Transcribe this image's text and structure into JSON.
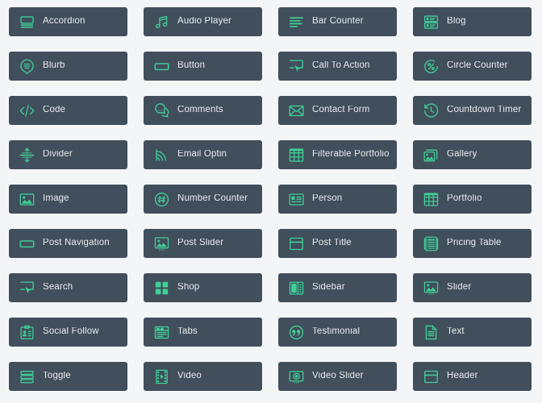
{
  "theme": {
    "page_background": "#f4f5f7",
    "tile_background": "#414e5c",
    "icon_color": "#3ecf96",
    "label_color": "#e9ecef"
  },
  "grid": {
    "columns": 4,
    "rows": 9,
    "total_modules": 36
  },
  "modules": [
    {
      "label": "Accordion",
      "icon": "accordion-icon"
    },
    {
      "label": "Audio Player",
      "icon": "music-note-icon"
    },
    {
      "label": "Bar Counter",
      "icon": "bar-counter-icon"
    },
    {
      "label": "Blog",
      "icon": "blog-list-icon"
    },
    {
      "label": "Blurb",
      "icon": "speech-bubble-lines-icon"
    },
    {
      "label": "Button",
      "icon": "rounded-rect-icon"
    },
    {
      "label": "Call To Action",
      "icon": "screen-cursor-icon"
    },
    {
      "label": "Circle Counter",
      "icon": "circle-percent-icon"
    },
    {
      "label": "Code",
      "icon": "code-brackets-icon"
    },
    {
      "label": "Comments",
      "icon": "comment-bubbles-icon"
    },
    {
      "label": "Contact Form",
      "icon": "envelope-icon"
    },
    {
      "label": "Countdown Timer",
      "icon": "clock-rewind-icon"
    },
    {
      "label": "Divider",
      "icon": "divider-arrows-icon"
    },
    {
      "label": "Email Optin",
      "icon": "rss-signal-icon"
    },
    {
      "label": "Filterable Portfolio",
      "icon": "grid-table-icon"
    },
    {
      "label": "Gallery",
      "icon": "stacked-photos-icon"
    },
    {
      "label": "Image",
      "icon": "photo-icon"
    },
    {
      "label": "Number Counter",
      "icon": "circle-hash-icon"
    },
    {
      "label": "Person",
      "icon": "id-card-icon"
    },
    {
      "label": "Portfolio",
      "icon": "grid-table-icon"
    },
    {
      "label": "Post Navigation",
      "icon": "rounded-rect-icon"
    },
    {
      "label": "Post Slider",
      "icon": "photo-slider-icon"
    },
    {
      "label": "Post Title",
      "icon": "window-title-icon"
    },
    {
      "label": "Pricing Table",
      "icon": "pricing-columns-icon"
    },
    {
      "label": "Search",
      "icon": "screen-cursor-icon"
    },
    {
      "label": "Shop",
      "icon": "four-squares-icon"
    },
    {
      "label": "Sidebar",
      "icon": "sidebar-panel-icon"
    },
    {
      "label": "Slider",
      "icon": "photo-slider-icon"
    },
    {
      "label": "Social Follow",
      "icon": "clipboard-person-icon"
    },
    {
      "label": "Tabs",
      "icon": "tabs-window-icon"
    },
    {
      "label": "Testimonial",
      "icon": "circle-quote-icon"
    },
    {
      "label": "Text",
      "icon": "document-lines-icon"
    },
    {
      "label": "Toggle",
      "icon": "stacked-bars-icon"
    },
    {
      "label": "Video",
      "icon": "film-play-icon"
    },
    {
      "label": "Video Slider",
      "icon": "video-camera-icon"
    },
    {
      "label": "Header",
      "icon": "window-title-icon"
    }
  ]
}
